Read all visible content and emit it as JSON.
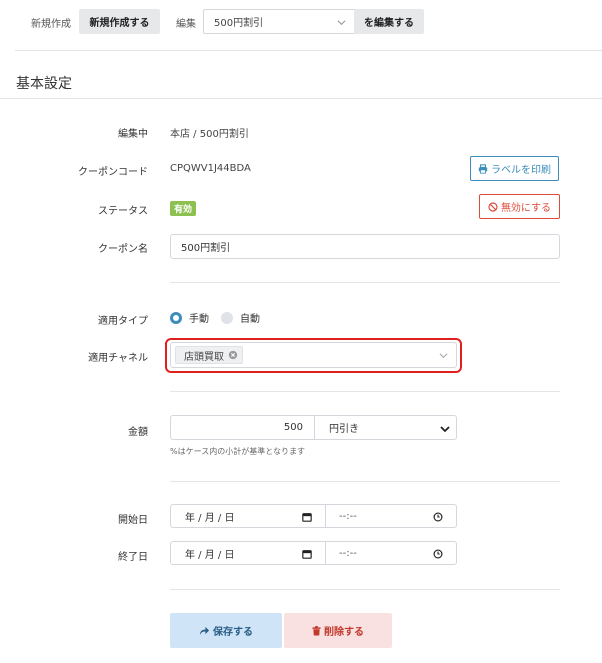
{
  "top_bar": {
    "new_label": "新規作成",
    "new_button": "新規作成する",
    "edit_label": "編集",
    "edit_select_value": "500円割引",
    "edit_button": "を編集する"
  },
  "section_title": "基本設定",
  "form": {
    "editing_label": "編集中",
    "editing_value": "本店 / 500円割引",
    "coupon_code_label": "クーポンコード",
    "coupon_code_value": "CPQWV1J44BDA",
    "print_label_button": "ラベルを印刷",
    "status_label": "ステータス",
    "status_badge": "有効",
    "disable_button": "無効にする",
    "coupon_name_label": "クーポン名",
    "coupon_name_value": "500円割引",
    "apply_type_label": "適用タイプ",
    "apply_type_options": [
      "手動",
      "自動"
    ],
    "apply_type_selected": "手動",
    "channel_label": "適用チャネル",
    "channel_tag": "店頭買取",
    "amount_label": "金額",
    "amount_value": "500",
    "amount_unit": "円引き",
    "amount_help": "%はケース内の小計が基準となります",
    "start_date_label": "開始日",
    "end_date_label": "終了日",
    "date_placeholder": "年 / 月 / 日",
    "time_placeholder": "--:--",
    "save_button": "保存する",
    "delete_button": "削除する"
  },
  "colors": {
    "primary_blue": "#3c8dbc",
    "danger_red": "#dd4b39",
    "success_green": "#8cc152",
    "highlight_red": "#e01f1f",
    "save_bg": "#cfe4f6",
    "delete_bg": "#f9e1e1"
  },
  "icons": [
    "printer-icon",
    "ban-icon",
    "close-circle-icon",
    "chevron-down-icon",
    "calendar-icon",
    "clock-icon",
    "share-icon",
    "trash-icon"
  ]
}
